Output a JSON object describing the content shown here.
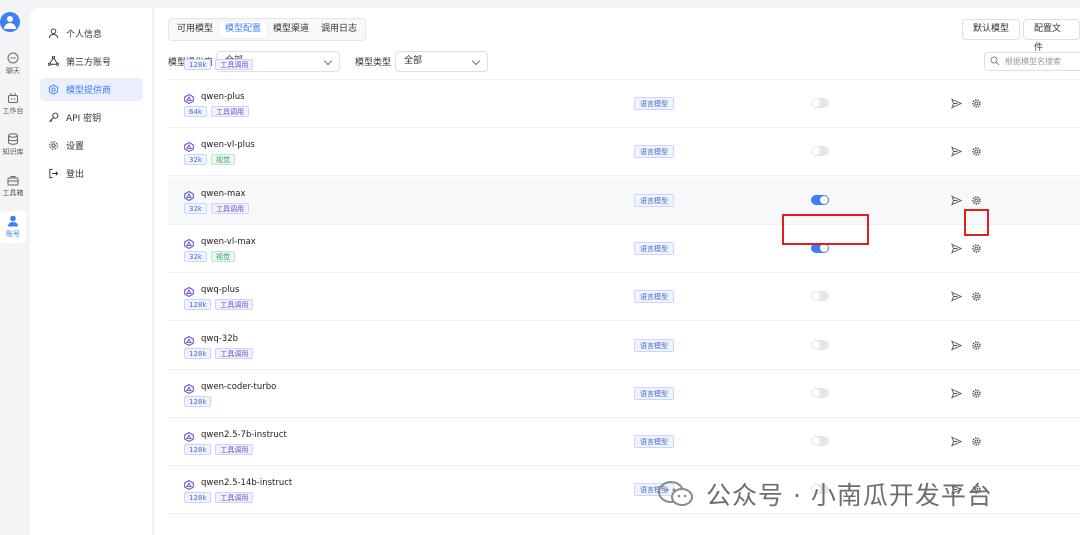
{
  "rail": [
    {
      "label": "聊天",
      "icon": "chat-icon"
    },
    {
      "label": "工作台",
      "icon": "robot-icon"
    },
    {
      "label": "知识库",
      "icon": "database-icon"
    },
    {
      "label": "工具箱",
      "icon": "toolbox-icon"
    },
    {
      "label": "账号",
      "icon": "user-icon",
      "active": true
    }
  ],
  "sidebar": {
    "items": [
      {
        "label": "个人信息",
        "icon": "user-icon"
      },
      {
        "label": "第三方账号",
        "icon": "share-icon"
      },
      {
        "label": "模型提供商",
        "icon": "model-provider-icon",
        "active": true
      },
      {
        "label": "API 密钥",
        "icon": "key-icon"
      },
      {
        "label": "设置",
        "icon": "gear-icon"
      },
      {
        "label": "登出",
        "icon": "logout-icon"
      }
    ]
  },
  "tabs": [
    "可用模型",
    "模型配置",
    "模型渠道",
    "调用日志"
  ],
  "active_tab": "模型配置",
  "buttons": {
    "default_model": "默认模型",
    "config_file": "配置文件"
  },
  "filters": {
    "provider_label": "模型提供商",
    "provider_value": "全部",
    "type_label": "模型类型",
    "type_value": "全部",
    "search_placeholder": "根据模型名搜索"
  },
  "partial_row": {
    "tags": [
      "128k",
      "工具调用"
    ]
  },
  "models": [
    {
      "name": "qwen-plus",
      "tags": [
        {
          "t": "64k",
          "k": "blue"
        },
        {
          "t": "工具调用",
          "k": "purple"
        }
      ],
      "type": "语言模型",
      "enabled": false
    },
    {
      "name": "qwen-vl-plus",
      "tags": [
        {
          "t": "32k",
          "k": "blue"
        },
        {
          "t": "视觉",
          "k": "green"
        }
      ],
      "type": "语言模型",
      "enabled": false
    },
    {
      "name": "qwen-max",
      "tags": [
        {
          "t": "32k",
          "k": "blue"
        },
        {
          "t": "工具调用",
          "k": "purple"
        }
      ],
      "type": "语言模型",
      "enabled": true
    },
    {
      "name": "qwen-vl-max",
      "tags": [
        {
          "t": "32k",
          "k": "blue"
        },
        {
          "t": "视觉",
          "k": "green"
        }
      ],
      "type": "语言模型",
      "enabled": true
    },
    {
      "name": "qwq-plus",
      "tags": [
        {
          "t": "128k",
          "k": "blue"
        },
        {
          "t": "工具调用",
          "k": "purple"
        }
      ],
      "type": "语言模型",
      "enabled": false
    },
    {
      "name": "qwq-32b",
      "tags": [
        {
          "t": "128k",
          "k": "blue"
        },
        {
          "t": "工具调用",
          "k": "purple"
        }
      ],
      "type": "语言模型",
      "enabled": false
    },
    {
      "name": "qwen-coder-turbo",
      "tags": [
        {
          "t": "128k",
          "k": "blue"
        }
      ],
      "type": "语言模型",
      "enabled": false
    },
    {
      "name": "qwen2.5-7b-instruct",
      "tags": [
        {
          "t": "128k",
          "k": "blue"
        },
        {
          "t": "工具调用",
          "k": "purple"
        }
      ],
      "type": "语言模型",
      "enabled": false
    },
    {
      "name": "qwen2.5-14b-instruct",
      "tags": [
        {
          "t": "128k",
          "k": "blue"
        },
        {
          "t": "工具调用",
          "k": "purple"
        }
      ],
      "type": "语言模型",
      "enabled": false
    }
  ],
  "watermark": "公众号 · 小南瓜开发平台",
  "colors": {
    "accent": "#3d7ff5",
    "highlight_box": "#e02020"
  }
}
